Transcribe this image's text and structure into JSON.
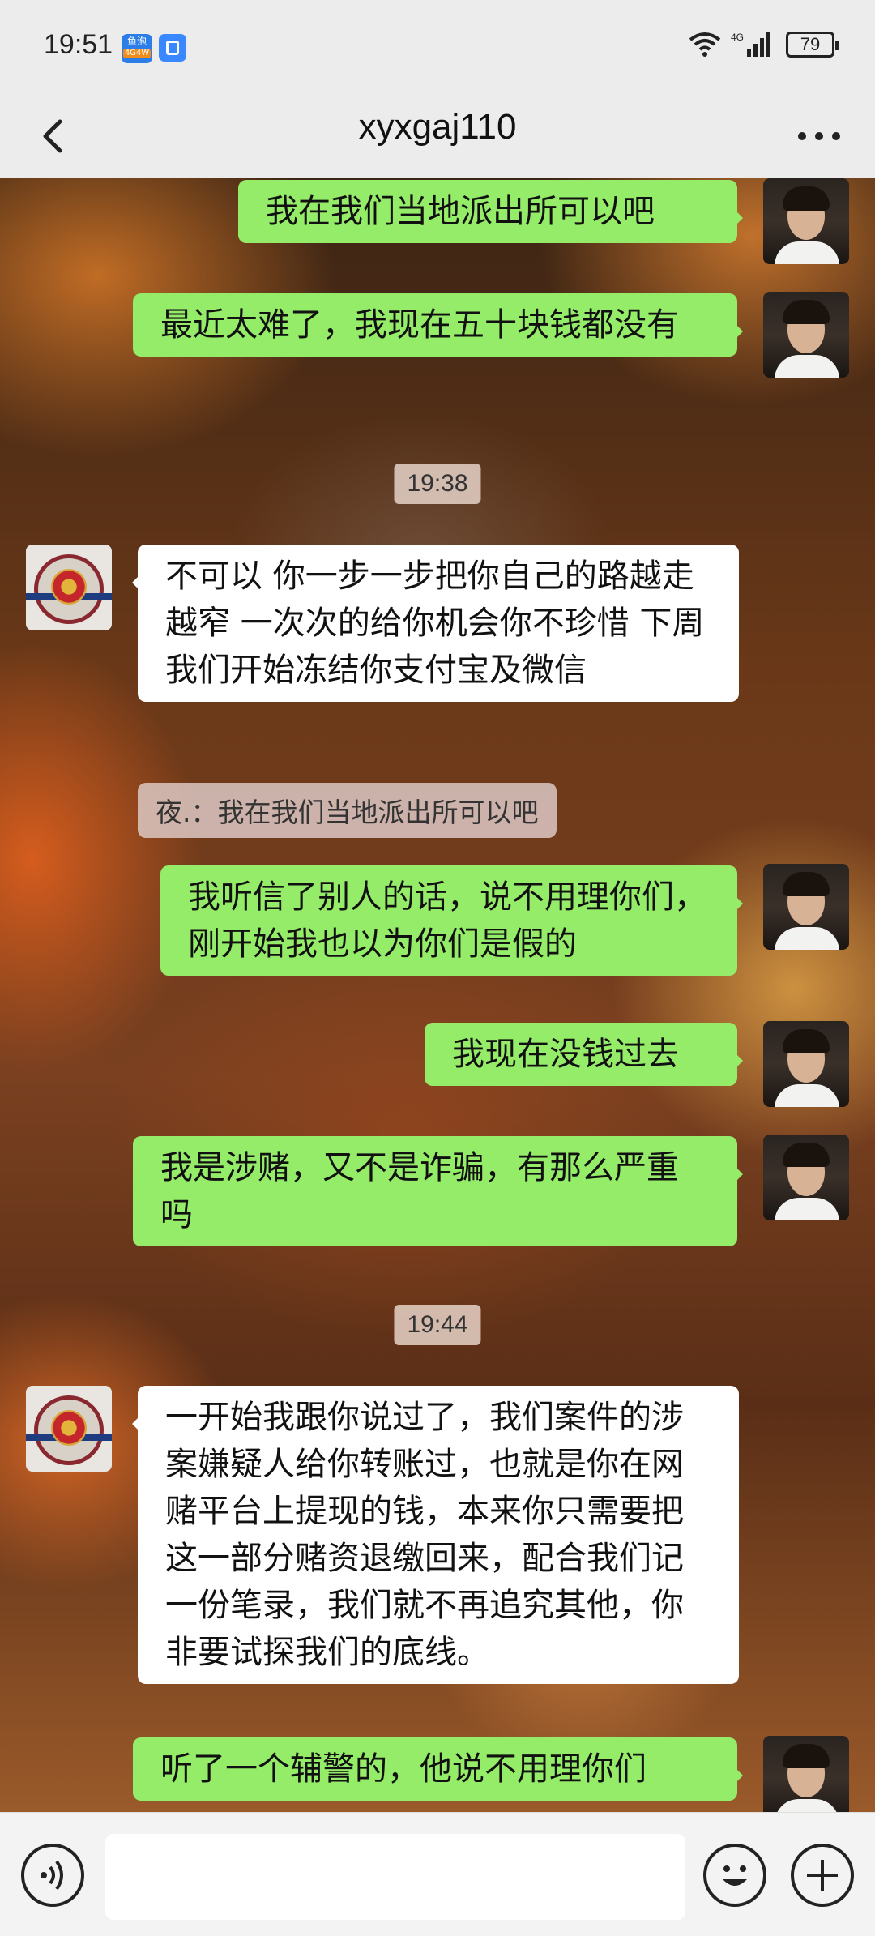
{
  "status_bar": {
    "time": "19:51",
    "app_badge_text": "鱼泡",
    "app_badge_sub": "4G4W",
    "network": "4G",
    "battery": "79"
  },
  "header": {
    "title": "xyxgaj110"
  },
  "messages": [
    {
      "type": "me",
      "text": "我在我们当地派出所可以吧"
    },
    {
      "type": "me",
      "text": "最近太难了，我现在五十块钱都没有"
    },
    {
      "type": "time",
      "text": "19:38"
    },
    {
      "type": "them",
      "text": "不可以 你一步一步把你自己的路越走越窄 一次次的给你机会你不珍惜 下周我们开始冻结你支付宝及微信"
    },
    {
      "type": "quote",
      "text": "夜.：我在我们当地派出所可以吧"
    },
    {
      "type": "me",
      "text": "我听信了别人的话，说不用理你们，刚开始我也以为你们是假的"
    },
    {
      "type": "me",
      "text": "我现在没钱过去"
    },
    {
      "type": "me",
      "text": "我是涉赌，又不是诈骗，有那么严重吗"
    },
    {
      "type": "time",
      "text": "19:44"
    },
    {
      "type": "them",
      "text": "一开始我跟你说过了，我们案件的涉案嫌疑人给你转账过，也就是你在网赌平台上提现的钱，本来你只需要把这一部分赌资退缴回来，配合我们记一份笔录，我们就不再追究其他，你非要试探我们的底线。"
    },
    {
      "type": "me",
      "text": "听了一个辅警的，他说不用理你们"
    }
  ],
  "input": {
    "placeholder": ""
  },
  "colors": {
    "my_bubble": "#95ec69",
    "their_bubble": "#ffffff",
    "bar": "#ececec"
  }
}
